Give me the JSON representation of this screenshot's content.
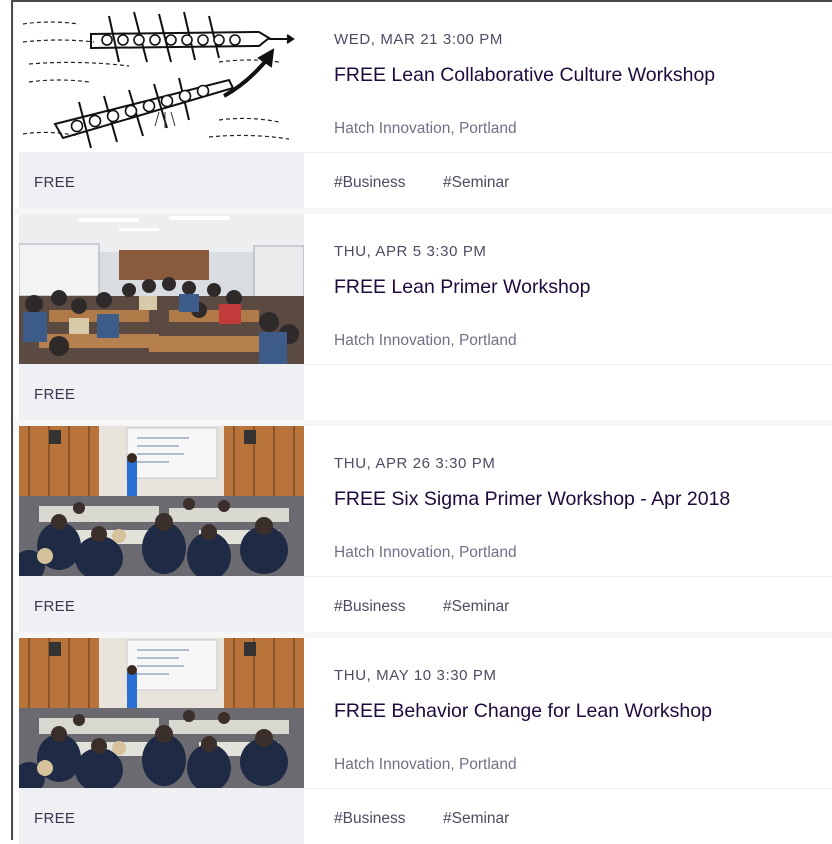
{
  "events": [
    {
      "image": "rowing-boats-sketch",
      "date": "WED, MAR 21 3:00 PM",
      "title": "FREE Lean Collaborative Culture Workshop",
      "venue": "Hatch Innovation, Portland",
      "price": "FREE",
      "tags": [
        "#Business",
        "#Seminar"
      ]
    },
    {
      "image": "workshop-room-photo",
      "date": "THU, APR 5 3:30 PM",
      "title": "FREE Lean Primer Workshop",
      "venue": "Hatch Innovation, Portland",
      "price": "FREE",
      "tags": []
    },
    {
      "image": "presentation-room-photo",
      "date": "THU, APR 26 3:30 PM",
      "title": "FREE Six Sigma Primer Workshop - Apr 2018",
      "venue": "Hatch Innovation, Portland",
      "price": "FREE",
      "tags": [
        "#Business",
        "#Seminar"
      ]
    },
    {
      "image": "presentation-room-photo",
      "date": "THU, MAY 10 3:30 PM",
      "title": "FREE Behavior Change for Lean Workshop",
      "venue": "Hatch Innovation, Portland",
      "price": "FREE",
      "tags": [
        "#Business",
        "#Seminar"
      ]
    }
  ]
}
